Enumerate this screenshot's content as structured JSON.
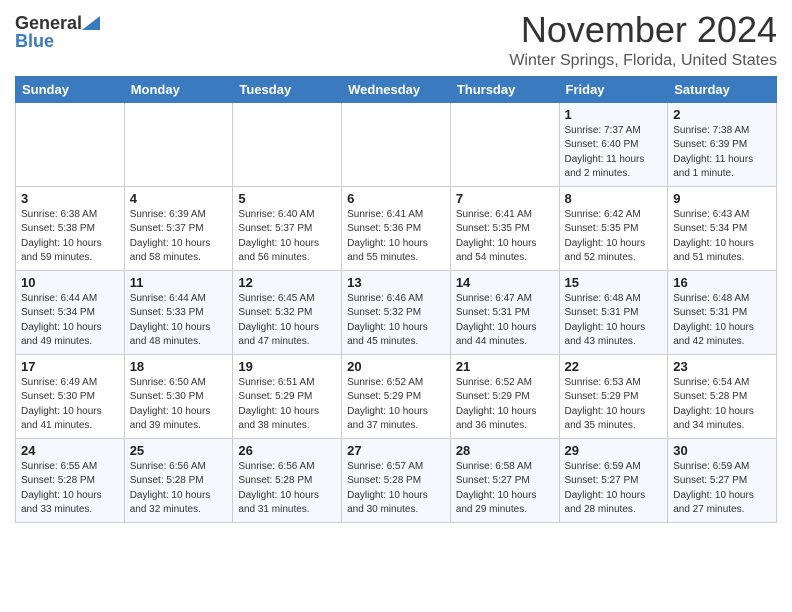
{
  "header": {
    "logo_general": "General",
    "logo_blue": "Blue",
    "month": "November 2024",
    "location": "Winter Springs, Florida, United States"
  },
  "weekdays": [
    "Sunday",
    "Monday",
    "Tuesday",
    "Wednesday",
    "Thursday",
    "Friday",
    "Saturday"
  ],
  "weeks": [
    [
      {
        "day": "",
        "info": ""
      },
      {
        "day": "",
        "info": ""
      },
      {
        "day": "",
        "info": ""
      },
      {
        "day": "",
        "info": ""
      },
      {
        "day": "",
        "info": ""
      },
      {
        "day": "1",
        "info": "Sunrise: 7:37 AM\nSunset: 6:40 PM\nDaylight: 11 hours\nand 2 minutes."
      },
      {
        "day": "2",
        "info": "Sunrise: 7:38 AM\nSunset: 6:39 PM\nDaylight: 11 hours\nand 1 minute."
      }
    ],
    [
      {
        "day": "3",
        "info": "Sunrise: 6:38 AM\nSunset: 5:38 PM\nDaylight: 10 hours\nand 59 minutes."
      },
      {
        "day": "4",
        "info": "Sunrise: 6:39 AM\nSunset: 5:37 PM\nDaylight: 10 hours\nand 58 minutes."
      },
      {
        "day": "5",
        "info": "Sunrise: 6:40 AM\nSunset: 5:37 PM\nDaylight: 10 hours\nand 56 minutes."
      },
      {
        "day": "6",
        "info": "Sunrise: 6:41 AM\nSunset: 5:36 PM\nDaylight: 10 hours\nand 55 minutes."
      },
      {
        "day": "7",
        "info": "Sunrise: 6:41 AM\nSunset: 5:35 PM\nDaylight: 10 hours\nand 54 minutes."
      },
      {
        "day": "8",
        "info": "Sunrise: 6:42 AM\nSunset: 5:35 PM\nDaylight: 10 hours\nand 52 minutes."
      },
      {
        "day": "9",
        "info": "Sunrise: 6:43 AM\nSunset: 5:34 PM\nDaylight: 10 hours\nand 51 minutes."
      }
    ],
    [
      {
        "day": "10",
        "info": "Sunrise: 6:44 AM\nSunset: 5:34 PM\nDaylight: 10 hours\nand 49 minutes."
      },
      {
        "day": "11",
        "info": "Sunrise: 6:44 AM\nSunset: 5:33 PM\nDaylight: 10 hours\nand 48 minutes."
      },
      {
        "day": "12",
        "info": "Sunrise: 6:45 AM\nSunset: 5:32 PM\nDaylight: 10 hours\nand 47 minutes."
      },
      {
        "day": "13",
        "info": "Sunrise: 6:46 AM\nSunset: 5:32 PM\nDaylight: 10 hours\nand 45 minutes."
      },
      {
        "day": "14",
        "info": "Sunrise: 6:47 AM\nSunset: 5:31 PM\nDaylight: 10 hours\nand 44 minutes."
      },
      {
        "day": "15",
        "info": "Sunrise: 6:48 AM\nSunset: 5:31 PM\nDaylight: 10 hours\nand 43 minutes."
      },
      {
        "day": "16",
        "info": "Sunrise: 6:48 AM\nSunset: 5:31 PM\nDaylight: 10 hours\nand 42 minutes."
      }
    ],
    [
      {
        "day": "17",
        "info": "Sunrise: 6:49 AM\nSunset: 5:30 PM\nDaylight: 10 hours\nand 41 minutes."
      },
      {
        "day": "18",
        "info": "Sunrise: 6:50 AM\nSunset: 5:30 PM\nDaylight: 10 hours\nand 39 minutes."
      },
      {
        "day": "19",
        "info": "Sunrise: 6:51 AM\nSunset: 5:29 PM\nDaylight: 10 hours\nand 38 minutes."
      },
      {
        "day": "20",
        "info": "Sunrise: 6:52 AM\nSunset: 5:29 PM\nDaylight: 10 hours\nand 37 minutes."
      },
      {
        "day": "21",
        "info": "Sunrise: 6:52 AM\nSunset: 5:29 PM\nDaylight: 10 hours\nand 36 minutes."
      },
      {
        "day": "22",
        "info": "Sunrise: 6:53 AM\nSunset: 5:29 PM\nDaylight: 10 hours\nand 35 minutes."
      },
      {
        "day": "23",
        "info": "Sunrise: 6:54 AM\nSunset: 5:28 PM\nDaylight: 10 hours\nand 34 minutes."
      }
    ],
    [
      {
        "day": "24",
        "info": "Sunrise: 6:55 AM\nSunset: 5:28 PM\nDaylight: 10 hours\nand 33 minutes."
      },
      {
        "day": "25",
        "info": "Sunrise: 6:56 AM\nSunset: 5:28 PM\nDaylight: 10 hours\nand 32 minutes."
      },
      {
        "day": "26",
        "info": "Sunrise: 6:56 AM\nSunset: 5:28 PM\nDaylight: 10 hours\nand 31 minutes."
      },
      {
        "day": "27",
        "info": "Sunrise: 6:57 AM\nSunset: 5:28 PM\nDaylight: 10 hours\nand 30 minutes."
      },
      {
        "day": "28",
        "info": "Sunrise: 6:58 AM\nSunset: 5:27 PM\nDaylight: 10 hours\nand 29 minutes."
      },
      {
        "day": "29",
        "info": "Sunrise: 6:59 AM\nSunset: 5:27 PM\nDaylight: 10 hours\nand 28 minutes."
      },
      {
        "day": "30",
        "info": "Sunrise: 6:59 AM\nSunset: 5:27 PM\nDaylight: 10 hours\nand 27 minutes."
      }
    ]
  ]
}
